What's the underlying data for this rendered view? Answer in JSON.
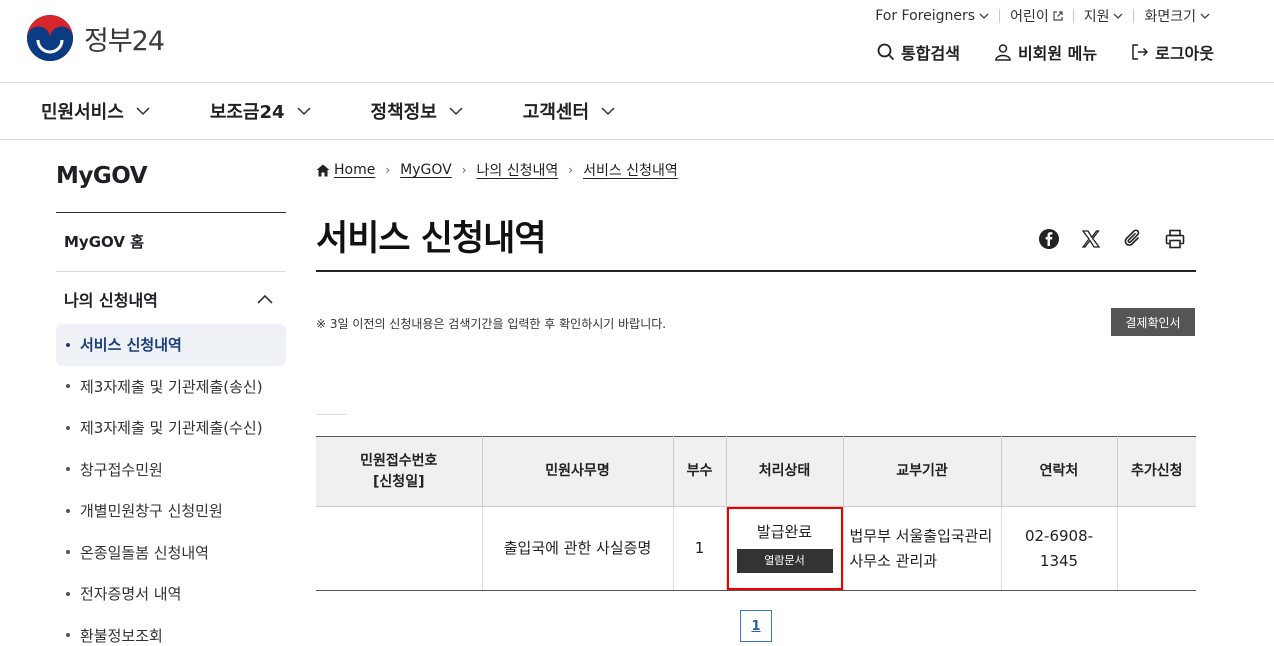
{
  "header": {
    "logo_text": "정부24",
    "util": [
      {
        "label": "For Foreigners"
      },
      {
        "label": "어린이"
      },
      {
        "label": "지원"
      },
      {
        "label": "화면크기"
      }
    ],
    "actions": [
      {
        "label": "통합검색",
        "icon": "search-icon"
      },
      {
        "label": "비회원 메뉴",
        "icon": "user-icon"
      },
      {
        "label": "로그아웃",
        "icon": "logout-icon"
      }
    ]
  },
  "mainnav": [
    "민원서비스",
    "보조금24",
    "정책정보",
    "고객센터"
  ],
  "sidebar": {
    "title": "MyGOV",
    "home": "MyGOV 홈",
    "group": "나의 신청내역",
    "items": [
      {
        "label": "서비스 신청내역",
        "active": true
      },
      {
        "label": "제3자제출 및 기관제출(송신)"
      },
      {
        "label": "제3자제출 및 기관제출(수신)"
      },
      {
        "label": "창구접수민원"
      },
      {
        "label": "개별민원창구 신청민원"
      },
      {
        "label": "온종일돌봄 신청내역"
      },
      {
        "label": "전자증명서 내역"
      },
      {
        "label": "환불정보조회"
      }
    ]
  },
  "breadcrumb": [
    "Home",
    "MyGOV",
    "나의 신청내역",
    "서비스 신청내역"
  ],
  "page_title": "서비스 신청내역",
  "share_icons": [
    "facebook-icon",
    "x-icon",
    "link-icon",
    "print-icon"
  ],
  "notice": "※ 3일 이전의 신청내용은 검색기간을 입력한 후 확인하시기 바랍니다.",
  "pay_button": "결제확인서",
  "table": {
    "headers": [
      "민원접수번호",
      "[신청일]",
      "민원사무명",
      "부수",
      "처리상태",
      "교부기관",
      "연락처",
      "추가신청"
    ],
    "row": {
      "receipt_no": "",
      "service_name": "출입국에 관한 사실증명",
      "copies": "1",
      "status": "발급완료",
      "status_button": "열람문서",
      "agency": "법무부 서울출입국관리사무소 관리과",
      "contact": "02-6908-1345",
      "extra": ""
    }
  },
  "pagination": {
    "current": "1"
  },
  "colors": {
    "accent": "#1c3f7a",
    "highlight": "#e00000",
    "button_dark": "#333333"
  }
}
